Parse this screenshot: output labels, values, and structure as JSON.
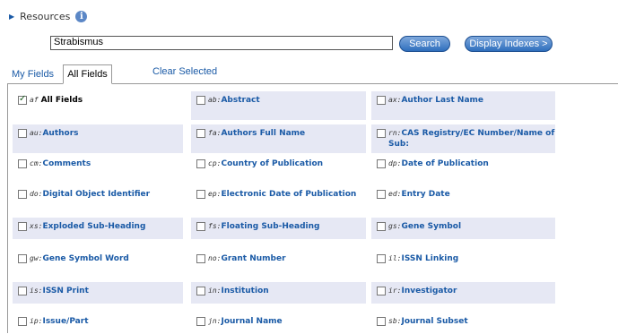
{
  "resources": {
    "label": "Resources",
    "info": "i"
  },
  "search": {
    "value": "Strabismus",
    "button": "Search",
    "display_indexes": "Display Indexes >"
  },
  "tabs": {
    "my_fields": "My Fields",
    "all_fields": "All Fields",
    "clear_selected": "Clear Selected"
  },
  "fields": [
    {
      "code": "af",
      "name": "All Fields",
      "checked": true
    },
    {
      "code": "ab",
      "name": "Abstract"
    },
    {
      "code": "ax",
      "name": "Author Last Name"
    },
    {
      "code": "au",
      "name": "Authors"
    },
    {
      "code": "fa",
      "name": "Authors Full Name"
    },
    {
      "code": "rn",
      "name": "CAS Registry/EC Number/Name of Sub:"
    },
    {
      "code": "cm",
      "name": "Comments"
    },
    {
      "code": "cp",
      "name": "Country of Publication"
    },
    {
      "code": "dp",
      "name": "Date of Publication"
    },
    {
      "code": "do",
      "name": "Digital Object Identifier"
    },
    {
      "code": "ep",
      "name": "Electronic Date of Publication"
    },
    {
      "code": "ed",
      "name": "Entry Date"
    },
    {
      "code": "xs",
      "name": "Exploded Sub-Heading"
    },
    {
      "code": "fs",
      "name": "Floating Sub-Heading"
    },
    {
      "code": "gs",
      "name": "Gene Symbol"
    },
    {
      "code": "gw",
      "name": "Gene Symbol Word"
    },
    {
      "code": "no",
      "name": "Grant Number"
    },
    {
      "code": "il",
      "name": "ISSN Linking"
    },
    {
      "code": "is",
      "name": "ISSN Print"
    },
    {
      "code": "in",
      "name": "Institution"
    },
    {
      "code": "ir",
      "name": "Investigator"
    },
    {
      "code": "ip",
      "name": "Issue/Part"
    },
    {
      "code": "jn",
      "name": "Journal Name"
    },
    {
      "code": "sb",
      "name": "Journal Subset"
    }
  ]
}
